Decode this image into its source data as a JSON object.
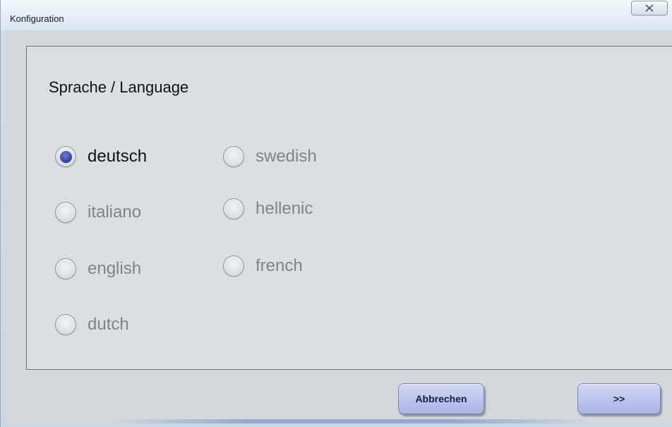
{
  "window": {
    "title": "Konfiguration",
    "close_icon": "close-x-icon"
  },
  "language_section": {
    "heading": "Sprache / Language",
    "selected": "deutsch",
    "options": [
      {
        "label": "deutsch",
        "checked": true
      },
      {
        "label": "italiano",
        "checked": false
      },
      {
        "label": "english",
        "checked": false
      },
      {
        "label": "dutch",
        "checked": false
      },
      {
        "label": "swedish",
        "checked": false
      },
      {
        "label": "hellenic",
        "checked": false
      },
      {
        "label": "french",
        "checked": false
      }
    ]
  },
  "buttons": {
    "cancel_label": "Abbrechen",
    "next_label": ">>"
  },
  "colors": {
    "radio_selected": "#3a47a6",
    "button_face": "#bcc6ee",
    "panel_background": "#dcdfe2"
  }
}
